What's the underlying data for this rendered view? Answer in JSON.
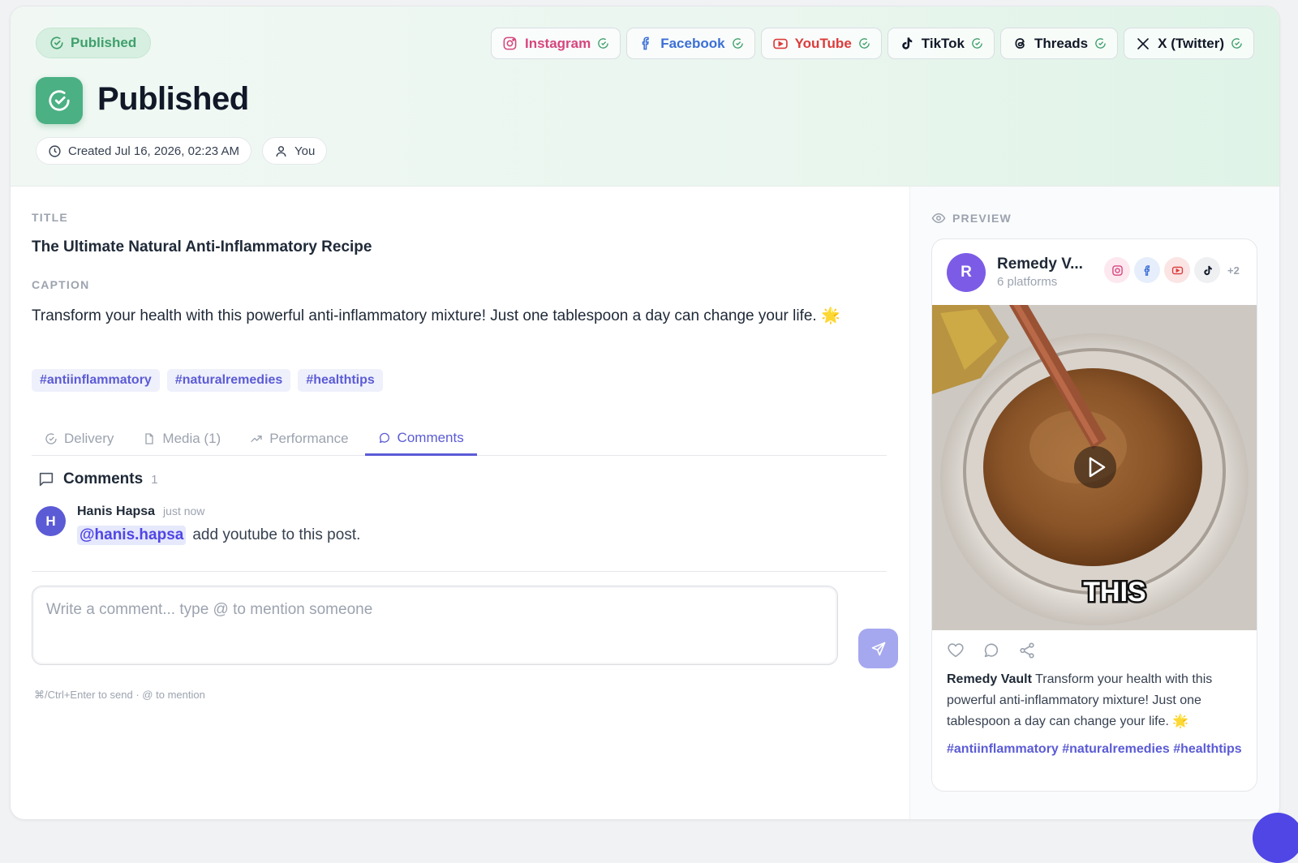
{
  "header": {
    "status_pill": "Published",
    "title": "Published",
    "created": "Created Jul 16, 2026, 02:23 AM",
    "author": "You",
    "platforms": [
      {
        "name": "Instagram",
        "icon": "instagram-icon",
        "color": "#d6467d"
      },
      {
        "name": "Facebook",
        "icon": "facebook-icon",
        "color": "#3b6fd6"
      },
      {
        "name": "YouTube",
        "icon": "youtube-icon",
        "color": "#dc3b3b"
      },
      {
        "name": "TikTok",
        "icon": "tiktok-icon",
        "color": "#111827"
      },
      {
        "name": "Threads",
        "icon": "threads-icon",
        "color": "#111827"
      },
      {
        "name": "X (Twitter)",
        "icon": "x-icon",
        "color": "#111827"
      }
    ]
  },
  "content": {
    "title_label": "TITLE",
    "title": "The Ultimate Natural Anti-Inflammatory Recipe",
    "caption_label": "CAPTION",
    "caption": "Transform your health with this powerful anti-inflammatory mixture! Just one tablespoon a day can change your life.",
    "caption_emoji": "🌟",
    "hashtags": [
      "#antiinflammatory",
      "#naturalremedies",
      "#healthtips"
    ]
  },
  "tabs": [
    {
      "label": "Delivery",
      "icon": "check-circle-icon",
      "active": false
    },
    {
      "label": "Media (1)",
      "icon": "file-icon",
      "active": false
    },
    {
      "label": "Performance",
      "icon": "trending-up-icon",
      "active": false
    },
    {
      "label": "Comments",
      "icon": "comment-icon",
      "active": true
    }
  ],
  "comments": {
    "heading": "Comments",
    "count": "1",
    "items": [
      {
        "initial": "H",
        "author": "Hanis Hapsa",
        "time": "just now",
        "mention": "@hanis.hapsa",
        "text": "add youtube to this post."
      }
    ],
    "input_placeholder": "Write a comment... type @ to mention someone",
    "hint": "⌘/Ctrl+Enter to send · @ to mention"
  },
  "preview": {
    "label": "PREVIEW",
    "initial": "R",
    "account_name": "Remedy V...",
    "platform_count": "6 platforms",
    "more_platforms": "+2",
    "video_overlay_text": "THIS",
    "caption_author": "Remedy Vault",
    "caption": "Transform your health with this powerful anti-inflammatory mixture! Just one tablespoon a day can change your life. 🌟",
    "hashtags": "#antiinflammatory #naturalremedies #healthtips"
  },
  "colors": {
    "accent": "#5b5bd6",
    "success": "#4bb083",
    "header_bg": "#eaf6ef"
  }
}
